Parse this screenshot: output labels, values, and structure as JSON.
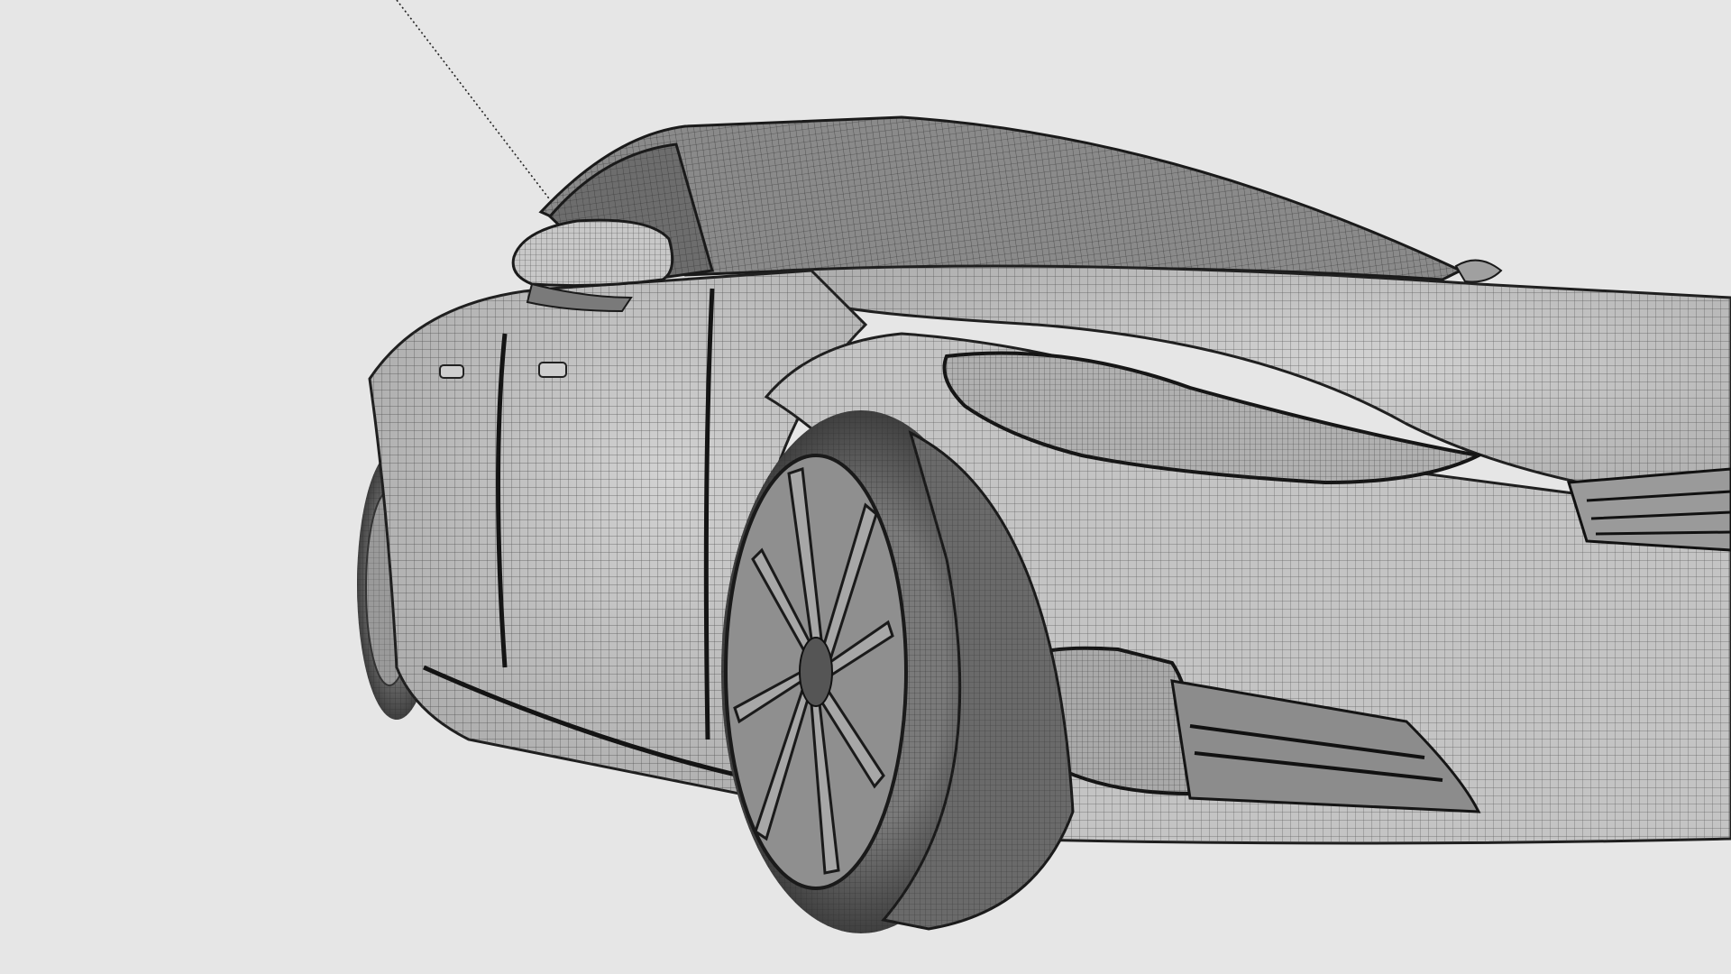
{
  "scene": {
    "subject": "car-wireframe-render",
    "colors": {
      "background": "#e6e6e6",
      "body_surface": "#b9b9b9",
      "body_light": "#cfcfcf",
      "glass": "#6d6d6d",
      "wire_line": "#2a2a2a",
      "tire": "#4a4a4a",
      "rim": "#8f8f8f"
    },
    "elements": {
      "guide_line": "dotted-guide-line",
      "car": "car-model",
      "front_wheel": "front-wheel",
      "rear_wheel": "rear-wheel",
      "mirror": "side-mirror",
      "headlight": "headlight",
      "fog_intake": "front-intake"
    }
  }
}
